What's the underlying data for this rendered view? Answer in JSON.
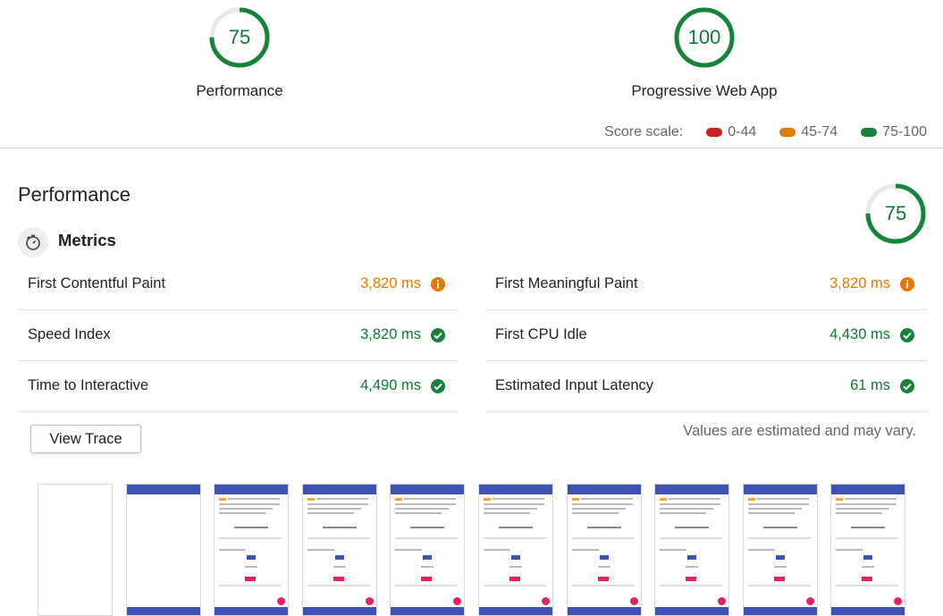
{
  "summary": {
    "gauges": [
      {
        "score": "75",
        "label": "Performance",
        "fraction": 0.75
      },
      {
        "score": "100",
        "label": "Progressive Web App",
        "fraction": 1.0
      }
    ],
    "score_scale": {
      "label": "Score scale:",
      "ranges": [
        {
          "text": "0-44",
          "color": "#c7221f"
        },
        {
          "text": "45-74",
          "color": "#e67700"
        },
        {
          "text": "75-100",
          "color": "#178239"
        }
      ]
    }
  },
  "performance": {
    "title": "Performance",
    "score": "75",
    "score_fraction": 0.75,
    "metrics_heading": "Metrics",
    "metrics": [
      {
        "name": "First Contentful Paint",
        "value": "3,820 ms",
        "status": "average"
      },
      {
        "name": "First Meaningful Paint",
        "value": "3,820 ms",
        "status": "average"
      },
      {
        "name": "Speed Index",
        "value": "3,820 ms",
        "status": "pass"
      },
      {
        "name": "First CPU Idle",
        "value": "4,430 ms",
        "status": "pass"
      },
      {
        "name": "Time to Interactive",
        "value": "4,490 ms",
        "status": "pass"
      },
      {
        "name": "Estimated Input Latency",
        "value": "61 ms",
        "status": "pass"
      }
    ],
    "view_trace_label": "View Trace",
    "estimate_note": "Values are estimated and may vary."
  },
  "colors": {
    "pass": "#178239",
    "average": "#e67700",
    "accent": "#3f51b5"
  },
  "filmstrip": {
    "frame_count": 10
  }
}
